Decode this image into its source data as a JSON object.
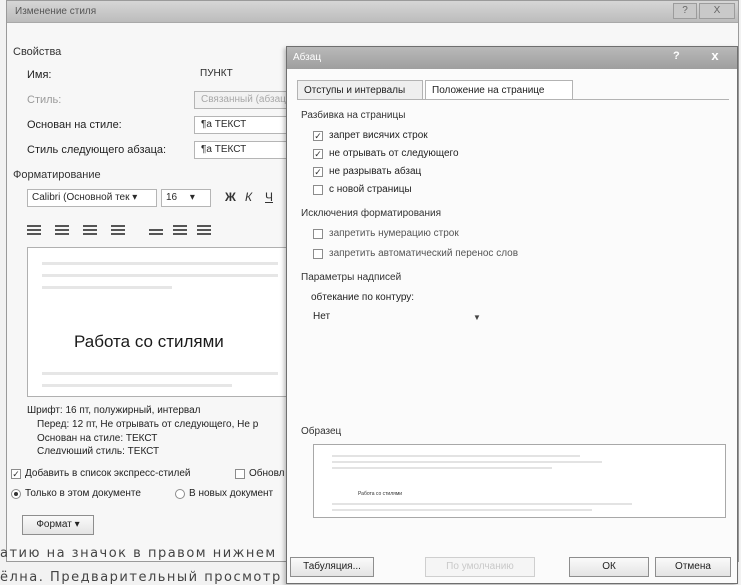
{
  "background_dialog": {
    "title": "Изменение стиля",
    "controls": {
      "help": "?",
      "close": "X"
    },
    "properties_section": "Свойства",
    "fields": [
      {
        "label": "Имя:",
        "value": "ПУНКТ"
      },
      {
        "label": "Стиль:",
        "value": "Связанный (абзац"
      },
      {
        "label": "Основан на стиле:",
        "value": "¶a ТЕКСТ"
      },
      {
        "label": "Стиль следующего абзаца:",
        "value": "¶a ТЕКСТ"
      }
    ],
    "formatting_section": "Форматирование",
    "font_name": "Calibri (Основной тек",
    "font_size": "16",
    "bold_label": "Ж",
    "italic_label": "К",
    "underline_label": "Ч",
    "preview_text": "Работа со стилями",
    "description_lines": [
      "Шрифт: 16 пт, полужирный, интервал",
      "Перед:  12 пт, Не отрывать от следующего, Не р",
      "Основан на стиле: ТЕКСТ",
      "Следующий стиль: ТЕКСТ"
    ],
    "add_to_quick_styles": "Добавить в список экспресс-стилей",
    "auto_update": "Обновл",
    "only_this_document": "Только в этом документе",
    "new_documents": "В новых документ",
    "format_button": "Формат ▾"
  },
  "book_text": [
    "атию на значок в правом нижнем",
    "   ёлна. Предварительный просмотр"
  ],
  "paragraph_dialog": {
    "title": "Абзац",
    "help": "?",
    "close": "x",
    "tabs": [
      {
        "label": "Отступы и интервалы",
        "active": false
      },
      {
        "label": "Положение на странице",
        "active": true
      }
    ],
    "pagination_group": "Разбивка на страницы",
    "pagination_options": [
      {
        "label": "запрет висячих строк",
        "checked": true
      },
      {
        "label": "не отрывать от следующего",
        "checked": true
      },
      {
        "label": "не разрывать абзац",
        "checked": true
      },
      {
        "label": "с новой страницы",
        "checked": false
      }
    ],
    "exceptions_group": "Исключения форматирования",
    "exceptions_options": [
      {
        "label": "запретить нумерацию строк",
        "checked": false
      },
      {
        "label": "запретить автоматический перенос слов",
        "checked": false
      }
    ],
    "textbox_group": "Параметры надписей",
    "wrap_label": "обтекание по контуру:",
    "wrap_value": "Нет",
    "sample_group": "Образец",
    "sample_text": "Работа со стилями",
    "buttons": {
      "tabs": "Табуляция...",
      "default": "По умолчанию",
      "ok": "ОК",
      "cancel": "Отмена"
    }
  }
}
